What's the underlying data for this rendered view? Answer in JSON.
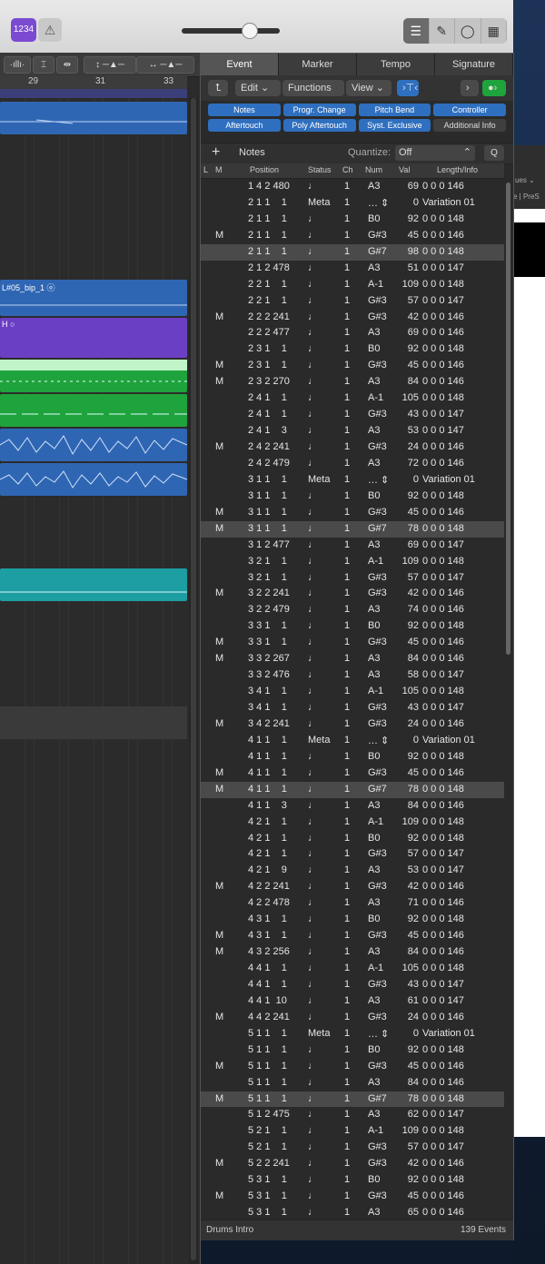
{
  "toolbar": {
    "lcd_mode": "1234",
    "metronome_icon": "metronome-icon",
    "group1": [
      "list-icon",
      "note-icon",
      "loop-icon",
      "browser-icon"
    ]
  },
  "tracks_area": {
    "ruler": [
      "29",
      "31",
      "33"
    ],
    "regions": [
      {
        "label": "",
        "color": "#2f66b3"
      },
      {
        "label": "L#05_bip_1 ⓞ",
        "color": "#2f66b3"
      },
      {
        "label": "H ○",
        "color": "#6b3fc4"
      },
      {
        "label": "",
        "color": "#bff5c8"
      },
      {
        "label": "",
        "color": "#1fa33c"
      },
      {
        "label": "",
        "color": "#2f66b3"
      },
      {
        "label": "",
        "color": "#2f66b3"
      },
      {
        "label": "",
        "color": "#1c9ea3"
      }
    ]
  },
  "event_list": {
    "tabs": [
      "Event",
      "Marker",
      "Tempo",
      "Signature"
    ],
    "toolbar": {
      "edit": "Edit",
      "functions": "Functions",
      "view": "View"
    },
    "filters": [
      "Notes",
      "Progr. Change",
      "Pitch Bend",
      "Controller",
      "Aftertouch",
      "Poly Aftertouch",
      "Syst. Exclusive",
      "Additional Info"
    ],
    "filters_on": [
      true,
      true,
      true,
      true,
      true,
      true,
      true,
      false
    ],
    "create_label": "Notes",
    "quantize_label": "Quantize:",
    "quantize_value": "Off",
    "q_button": "Q",
    "columns": [
      "L",
      "M",
      "Position",
      "Status",
      "Ch",
      "Num",
      "Val",
      "Length/Info"
    ],
    "rows": [
      [
        "",
        "1 4 2 480",
        "♩",
        "1",
        "A3",
        "69",
        "0 0 0 146",
        false
      ],
      [
        "",
        "2 1 1    1",
        "Meta",
        "1",
        "…  ⇕",
        "0",
        "Variation 01",
        false
      ],
      [
        "",
        "2 1 1    1",
        "♩",
        "1",
        "B0",
        "92",
        "0 0 0 148",
        false
      ],
      [
        "M",
        "2 1 1    1",
        "♩",
        "1",
        "G#3",
        "45",
        "0 0 0 146",
        false
      ],
      [
        "",
        "2 1 1    1",
        "♩",
        "1",
        "G#7",
        "98",
        "0 0 0 148",
        true
      ],
      [
        "",
        "2 1 2 478",
        "♩",
        "1",
        "A3",
        "51",
        "0 0 0 147",
        false
      ],
      [
        "",
        "2 2 1    1",
        "♩",
        "1",
        "A-1",
        "109",
        "0 0 0 148",
        false
      ],
      [
        "",
        "2 2 1    1",
        "♩",
        "1",
        "G#3",
        "57",
        "0 0 0 147",
        false
      ],
      [
        "M",
        "2 2 2 241",
        "♩",
        "1",
        "G#3",
        "42",
        "0 0 0 146",
        false
      ],
      [
        "",
        "2 2 2 477",
        "♩",
        "1",
        "A3",
        "69",
        "0 0 0 146",
        false
      ],
      [
        "",
        "2 3 1    1",
        "♩",
        "1",
        "B0",
        "92",
        "0 0 0 148",
        false
      ],
      [
        "M",
        "2 3 1    1",
        "♩",
        "1",
        "G#3",
        "45",
        "0 0 0 146",
        false
      ],
      [
        "M",
        "2 3 2 270",
        "♩",
        "1",
        "A3",
        "84",
        "0 0 0 146",
        false
      ],
      [
        "",
        "2 4 1    1",
        "♩",
        "1",
        "A-1",
        "105",
        "0 0 0 148",
        false
      ],
      [
        "",
        "2 4 1    1",
        "♩",
        "1",
        "G#3",
        "43",
        "0 0 0 147",
        false
      ],
      [
        "",
        "2 4 1    3",
        "♩",
        "1",
        "A3",
        "53",
        "0 0 0 147",
        false
      ],
      [
        "M",
        "2 4 2 241",
        "♩",
        "1",
        "G#3",
        "24",
        "0 0 0 146",
        false
      ],
      [
        "",
        "2 4 2 479",
        "♩",
        "1",
        "A3",
        "72",
        "0 0 0 146",
        false
      ],
      [
        "",
        "3 1 1    1",
        "Meta",
        "1",
        "…  ⇕",
        "0",
        "Variation 01",
        false
      ],
      [
        "",
        "3 1 1    1",
        "♩",
        "1",
        "B0",
        "92",
        "0 0 0 148",
        false
      ],
      [
        "M",
        "3 1 1    1",
        "♩",
        "1",
        "G#3",
        "45",
        "0 0 0 146",
        false
      ],
      [
        "M",
        "3 1 1    1",
        "♩",
        "1",
        "G#7",
        "78",
        "0 0 0 148",
        true
      ],
      [
        "",
        "3 1 2 477",
        "♩",
        "1",
        "A3",
        "69",
        "0 0 0 147",
        false
      ],
      [
        "",
        "3 2 1    1",
        "♩",
        "1",
        "A-1",
        "109",
        "0 0 0 148",
        false
      ],
      [
        "",
        "3 2 1    1",
        "♩",
        "1",
        "G#3",
        "57",
        "0 0 0 147",
        false
      ],
      [
        "M",
        "3 2 2 241",
        "♩",
        "1",
        "G#3",
        "42",
        "0 0 0 146",
        false
      ],
      [
        "",
        "3 2 2 479",
        "♩",
        "1",
        "A3",
        "74",
        "0 0 0 146",
        false
      ],
      [
        "",
        "3 3 1    1",
        "♩",
        "1",
        "B0",
        "92",
        "0 0 0 148",
        false
      ],
      [
        "M",
        "3 3 1    1",
        "♩",
        "1",
        "G#3",
        "45",
        "0 0 0 146",
        false
      ],
      [
        "M",
        "3 3 2 267",
        "♩",
        "1",
        "A3",
        "84",
        "0 0 0 146",
        false
      ],
      [
        "",
        "3 3 2 476",
        "♩",
        "1",
        "A3",
        "58",
        "0 0 0 147",
        false
      ],
      [
        "",
        "3 4 1    1",
        "♩",
        "1",
        "A-1",
        "105",
        "0 0 0 148",
        false
      ],
      [
        "",
        "3 4 1    1",
        "♩",
        "1",
        "G#3",
        "43",
        "0 0 0 147",
        false
      ],
      [
        "M",
        "3 4 2 241",
        "♩",
        "1",
        "G#3",
        "24",
        "0 0 0 146",
        false
      ],
      [
        "",
        "4 1 1    1",
        "Meta",
        "1",
        "…  ⇕",
        "0",
        "Variation 01",
        false
      ],
      [
        "",
        "4 1 1    1",
        "♩",
        "1",
        "B0",
        "92",
        "0 0 0 148",
        false
      ],
      [
        "M",
        "4 1 1    1",
        "♩",
        "1",
        "G#3",
        "45",
        "0 0 0 146",
        false
      ],
      [
        "M",
        "4 1 1    1",
        "♩",
        "1",
        "G#7",
        "78",
        "0 0 0 148",
        true
      ],
      [
        "",
        "4 1 1    3",
        "♩",
        "1",
        "A3",
        "84",
        "0 0 0 146",
        false
      ],
      [
        "",
        "4 2 1    1",
        "♩",
        "1",
        "A-1",
        "109",
        "0 0 0 148",
        false
      ],
      [
        "",
        "4 2 1    1",
        "♩",
        "1",
        "B0",
        "92",
        "0 0 0 148",
        false
      ],
      [
        "",
        "4 2 1    1",
        "♩",
        "1",
        "G#3",
        "57",
        "0 0 0 147",
        false
      ],
      [
        "",
        "4 2 1    9",
        "♩",
        "1",
        "A3",
        "53",
        "0 0 0 147",
        false
      ],
      [
        "M",
        "4 2 2 241",
        "♩",
        "1",
        "G#3",
        "42",
        "0 0 0 146",
        false
      ],
      [
        "",
        "4 2 2 478",
        "♩",
        "1",
        "A3",
        "71",
        "0 0 0 146",
        false
      ],
      [
        "",
        "4 3 1    1",
        "♩",
        "1",
        "B0",
        "92",
        "0 0 0 148",
        false
      ],
      [
        "M",
        "4 3 1    1",
        "♩",
        "1",
        "G#3",
        "45",
        "0 0 0 146",
        false
      ],
      [
        "M",
        "4 3 2 256",
        "♩",
        "1",
        "A3",
        "84",
        "0 0 0 146",
        false
      ],
      [
        "",
        "4 4 1    1",
        "♩",
        "1",
        "A-1",
        "105",
        "0 0 0 148",
        false
      ],
      [
        "",
        "4 4 1    1",
        "♩",
        "1",
        "G#3",
        "43",
        "0 0 0 147",
        false
      ],
      [
        "",
        "4 4 1  10",
        "♩",
        "1",
        "A3",
        "61",
        "0 0 0 147",
        false
      ],
      [
        "M",
        "4 4 2 241",
        "♩",
        "1",
        "G#3",
        "24",
        "0 0 0 146",
        false
      ],
      [
        "",
        "5 1 1    1",
        "Meta",
        "1",
        "…  ⇕",
        "0",
        "Variation 01",
        false
      ],
      [
        "",
        "5 1 1    1",
        "♩",
        "1",
        "B0",
        "92",
        "0 0 0 148",
        false
      ],
      [
        "M",
        "5 1 1    1",
        "♩",
        "1",
        "G#3",
        "45",
        "0 0 0 146",
        false
      ],
      [
        "",
        "5 1 1    1",
        "♩",
        "1",
        "A3",
        "84",
        "0 0 0 146",
        false
      ],
      [
        "M",
        "5 1 1    1",
        "♩",
        "1",
        "G#7",
        "78",
        "0 0 0 148",
        true
      ],
      [
        "",
        "5 1 2 475",
        "♩",
        "1",
        "A3",
        "62",
        "0 0 0 147",
        false
      ],
      [
        "",
        "5 2 1    1",
        "♩",
        "1",
        "A-1",
        "109",
        "0 0 0 148",
        false
      ],
      [
        "",
        "5 2 1    1",
        "♩",
        "1",
        "G#3",
        "57",
        "0 0 0 147",
        false
      ],
      [
        "M",
        "5 2 2 241",
        "♩",
        "1",
        "G#3",
        "42",
        "0 0 0 146",
        false
      ],
      [
        "",
        "5 3 1    1",
        "♩",
        "1",
        "B0",
        "92",
        "0 0 0 148",
        false
      ],
      [
        "M",
        "5 3 1    1",
        "♩",
        "1",
        "G#3",
        "45",
        "0 0 0 146",
        false
      ],
      [
        "",
        "5 3 1    1",
        "♩",
        "1",
        "A3",
        "65",
        "0 0 0 146",
        false
      ]
    ],
    "status_left": "Drums Intro",
    "status_right": "139 Events"
  },
  "desktop": {
    "text1": "ues ⌄",
    "text2": "e | PreS"
  }
}
